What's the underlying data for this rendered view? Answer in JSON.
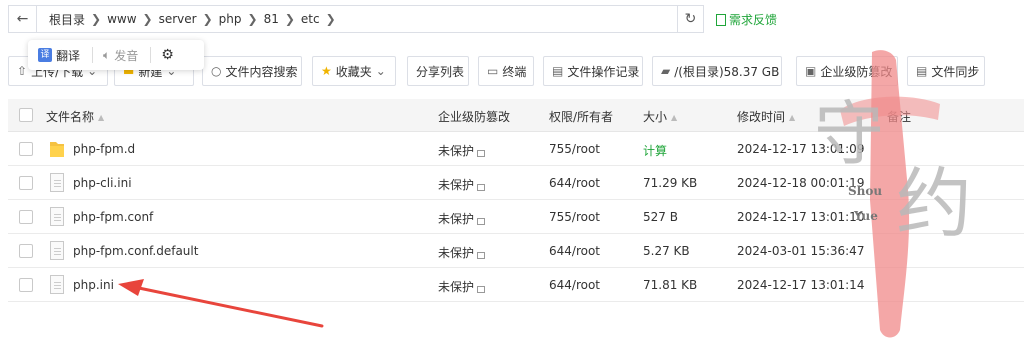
{
  "path": {
    "crumbs": [
      "根目录",
      "www",
      "server",
      "php",
      "81",
      "etc"
    ]
  },
  "feedback_label": "需求反馈",
  "popup": {
    "translate": "翻译",
    "speak": "发音"
  },
  "toolbar": {
    "upload": "上传/下载",
    "new": "新建",
    "content_search": "文件内容搜索",
    "favorites": "收藏夹",
    "share_list": "分享列表",
    "terminal": "终端",
    "op_log": "文件操作记录",
    "disk": "/(根目录)58.37 GB",
    "tamper": "企业级防篡改",
    "sync": "文件同步"
  },
  "table": {
    "headers": {
      "name": "文件名称",
      "tamper": "企业级防篡改",
      "perm": "权限/所有者",
      "size": "大小",
      "mtime": "修改时间",
      "note": "备注"
    },
    "rows": [
      {
        "name": "php-fpm.d",
        "tamper": "未保护",
        "perm": "755/root",
        "size": "计算",
        "mtime": "2024-12-17 13:01:09",
        "type": "folder"
      },
      {
        "name": "php-cli.ini",
        "tamper": "未保护",
        "perm": "644/root",
        "size": "71.29 KB",
        "mtime": "2024-12-18 00:01:19",
        "type": "file"
      },
      {
        "name": "php-fpm.conf",
        "tamper": "未保护",
        "perm": "755/root",
        "size": "527 B",
        "mtime": "2024-12-17 13:01:10",
        "type": "file"
      },
      {
        "name": "php-fpm.conf.default",
        "tamper": "未保护",
        "perm": "644/root",
        "size": "5.27 KB",
        "mtime": "2024-03-01 15:36:47",
        "type": "file"
      },
      {
        "name": "php.ini",
        "tamper": "未保护",
        "perm": "644/root",
        "size": "71.81 KB",
        "mtime": "2024-12-17 13:01:14",
        "type": "file"
      }
    ]
  },
  "watermark": {
    "chars": "守约",
    "latin_top": "Shou",
    "latin_bottom": "Yue"
  },
  "colors": {
    "accent": "#20a53a",
    "arrow": "#e8453c",
    "watermark": "#f08a8a"
  }
}
